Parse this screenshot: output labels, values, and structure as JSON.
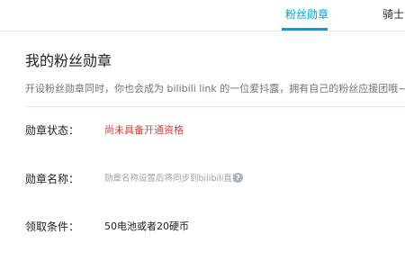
{
  "tabs": {
    "fans_badge": "粉丝勋章",
    "knight": "骑士"
  },
  "section": {
    "title": "我的粉丝勋章",
    "description": "开设粉丝勋章同时，你也会成为 bilibili link 的一位爱抖露，拥有自己的粉丝应援团哦~"
  },
  "rows": {
    "status": {
      "label": "勋章状态：",
      "value": "尚未具备开通资格"
    },
    "name": {
      "label": "勋章名称：",
      "value": "勋章名称设置后将同步到bilibili直播",
      "help_icon": "?"
    },
    "condition": {
      "label": "领取条件：",
      "value": "50电池或者20硬币"
    }
  },
  "colors": {
    "accent": "#00a1d6",
    "status_red": "#e0413a",
    "muted": "#99a2aa"
  }
}
